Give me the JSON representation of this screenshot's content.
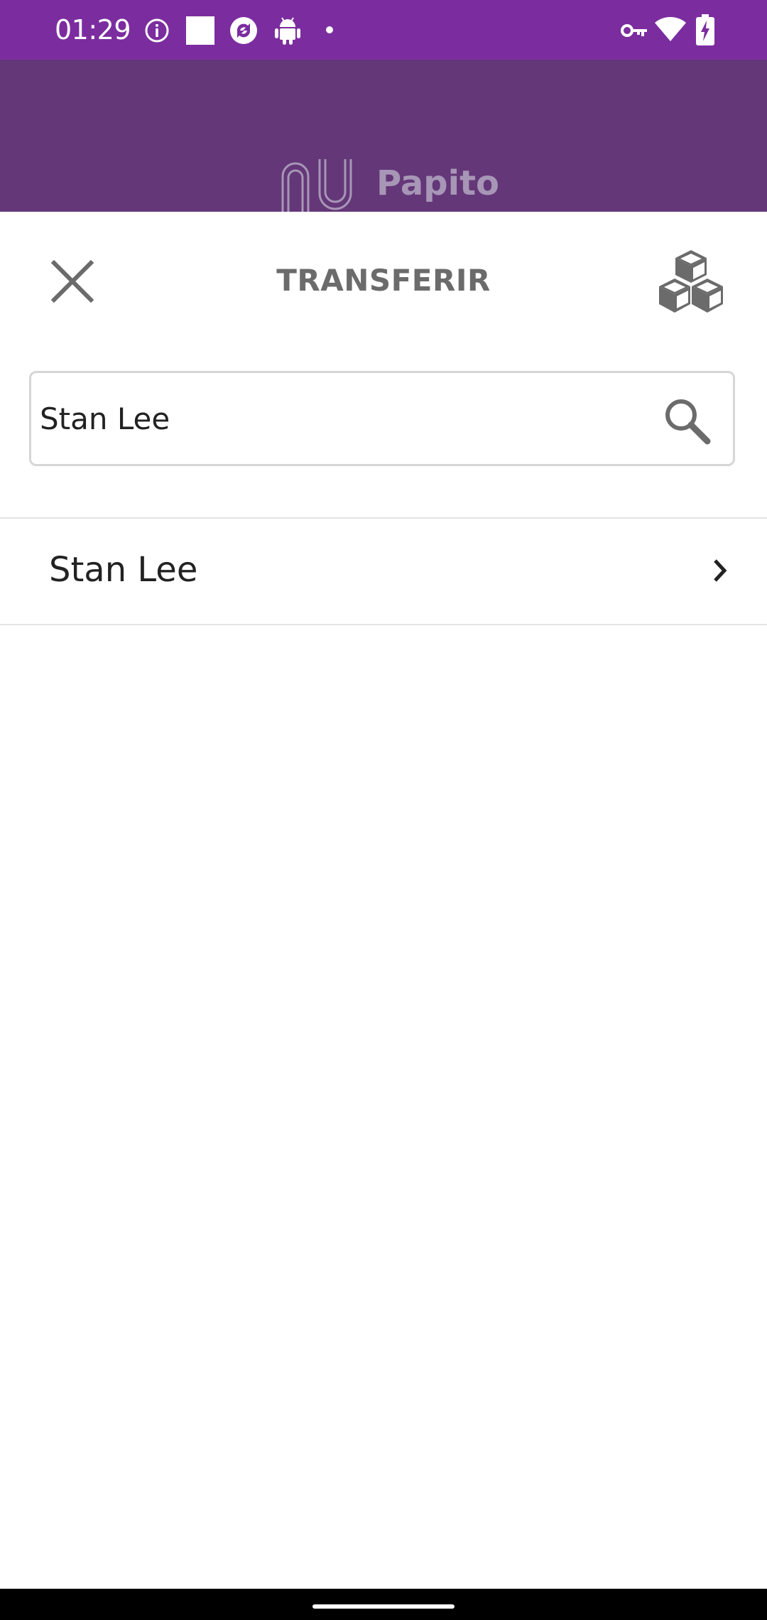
{
  "status_bar": {
    "time": "01:29",
    "left_icons": [
      "info-icon",
      "square-icon",
      "data-saver-icon",
      "android-icon",
      "dot-icon"
    ],
    "right_icons": [
      "vpn-key-icon",
      "wifi-icon",
      "battery-charging-icon"
    ],
    "background": "#7b2d9f"
  },
  "app_header": {
    "brand_name": "Papito",
    "logo": "nu-logo",
    "background": "#643778"
  },
  "sheet": {
    "title": "TRANSFERIR",
    "close_icon": "close-icon",
    "action_icon": "cubes-icon"
  },
  "search": {
    "value": "Stan Lee",
    "icon": "search-icon"
  },
  "results": [
    {
      "name": "Stan Lee",
      "icon": "chevron-right-icon"
    }
  ]
}
